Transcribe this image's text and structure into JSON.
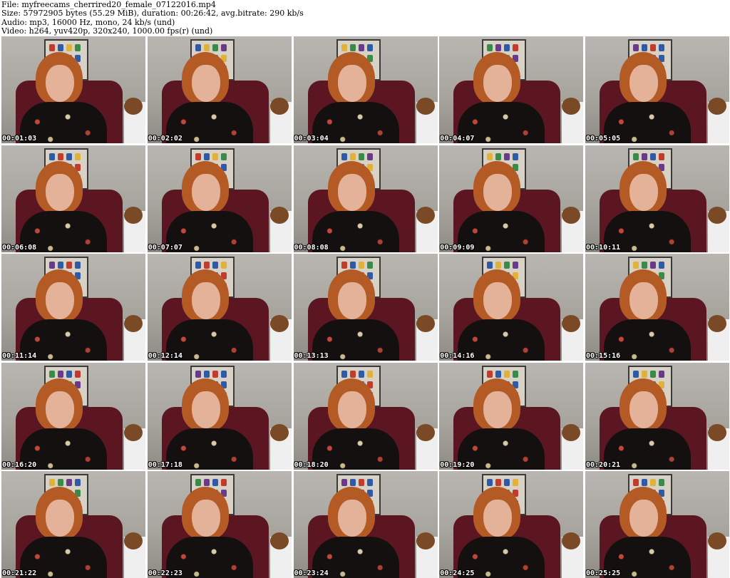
{
  "header": {
    "lines": [
      "File: myfreecams_cherrired20_female_07122016.mp4",
      "Size: 57972905 bytes (55.29 MiB), duration: 00:26:42, avg.bitrate: 290 kb/s",
      "Audio: mp3, 16000 Hz, mono, 24 kb/s (und)",
      "Video: h264, yuv420p, 320x240, 1000.00 fps(r) (und)"
    ]
  },
  "thumbnails": [
    {
      "timestamp": "00:01:03"
    },
    {
      "timestamp": "00:02:02"
    },
    {
      "timestamp": "00:03:04"
    },
    {
      "timestamp": "00:04:07"
    },
    {
      "timestamp": "00:05:05"
    },
    {
      "timestamp": "00:06:08"
    },
    {
      "timestamp": "00:07:07"
    },
    {
      "timestamp": "00:08:08"
    },
    {
      "timestamp": "00:09:09"
    },
    {
      "timestamp": "00:10:11"
    },
    {
      "timestamp": "00:11:14"
    },
    {
      "timestamp": "00:12:14"
    },
    {
      "timestamp": "00:13:13"
    },
    {
      "timestamp": "00:14:16"
    },
    {
      "timestamp": "00:15:16"
    },
    {
      "timestamp": "00:16:20"
    },
    {
      "timestamp": "00:17:18"
    },
    {
      "timestamp": "00:18:20"
    },
    {
      "timestamp": "00:19:20"
    },
    {
      "timestamp": "00:20:21"
    },
    {
      "timestamp": "00:21:22"
    },
    {
      "timestamp": "00:22:23"
    },
    {
      "timestamp": "00:23:24"
    },
    {
      "timestamp": "00:24:25"
    },
    {
      "timestamp": "00:25:25"
    }
  ]
}
